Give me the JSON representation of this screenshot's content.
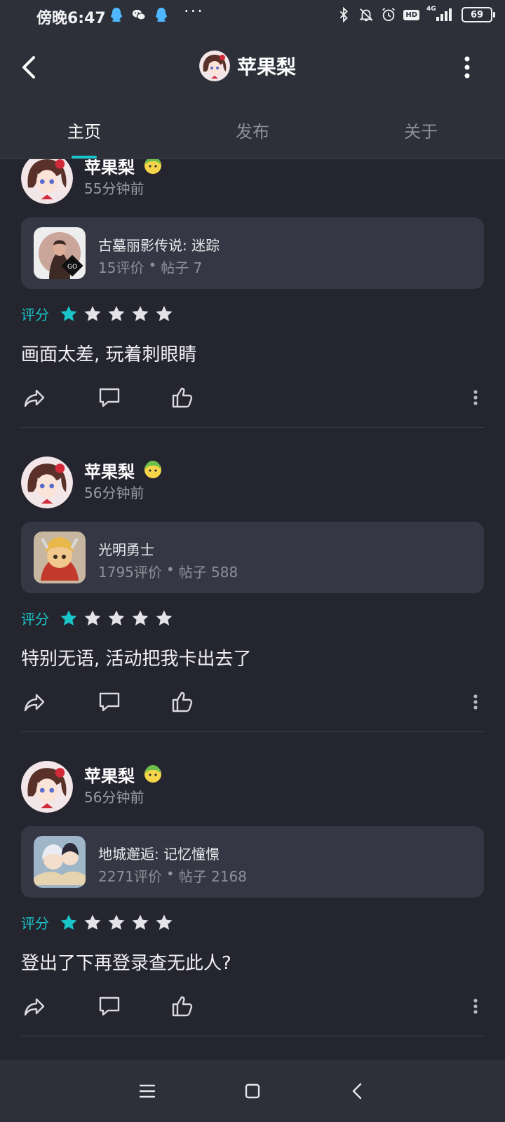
{
  "status_bar": {
    "time": "傍晚6:47",
    "network": "4G",
    "hd": "HD",
    "battery": "69"
  },
  "header": {
    "title": "苹果梨"
  },
  "tabs": [
    {
      "label": "主页",
      "active": true
    },
    {
      "label": "发布",
      "active": false
    },
    {
      "label": "关于",
      "active": false
    }
  ],
  "posts": [
    {
      "user": "苹果梨",
      "time": "55分钟前",
      "game": {
        "name": "古墓丽影传说: 迷踪",
        "reviews": "15评价",
        "sep": "•",
        "posts": "帖子 7"
      },
      "rating_label": "评分",
      "rating": 1,
      "rating_max": 5,
      "content": "画面太差, 玩着刺眼睛"
    },
    {
      "user": "苹果梨",
      "time": "56分钟前",
      "game": {
        "name": "光明勇士",
        "reviews": "1795评价",
        "sep": "•",
        "posts": "帖子 588"
      },
      "rating_label": "评分",
      "rating": 1,
      "rating_max": 5,
      "content": "特别无语, 活动把我卡出去了"
    },
    {
      "user": "苹果梨",
      "time": "56分钟前",
      "game": {
        "name": "地城邂逅: 记忆憧憬",
        "reviews": "2271评价",
        "sep": "•",
        "posts": "帖子 2168"
      },
      "rating_label": "评分",
      "rating": 1,
      "rating_max": 5,
      "content": "登出了下再登录查无此人?"
    }
  ],
  "colors": {
    "accent": "#19c5c9",
    "background": "#24252f",
    "bar": "#2d3039",
    "card": "#353844",
    "star_empty": "#e4e4e8"
  },
  "icons": {
    "back": "chevron-left-icon",
    "more": "more-vertical-icon",
    "share": "share-icon",
    "comment": "comment-icon",
    "like": "thumbs-up-icon",
    "nav_menu": "menu-icon",
    "nav_home": "square-icon",
    "nav_back": "chevron-left-icon"
  }
}
